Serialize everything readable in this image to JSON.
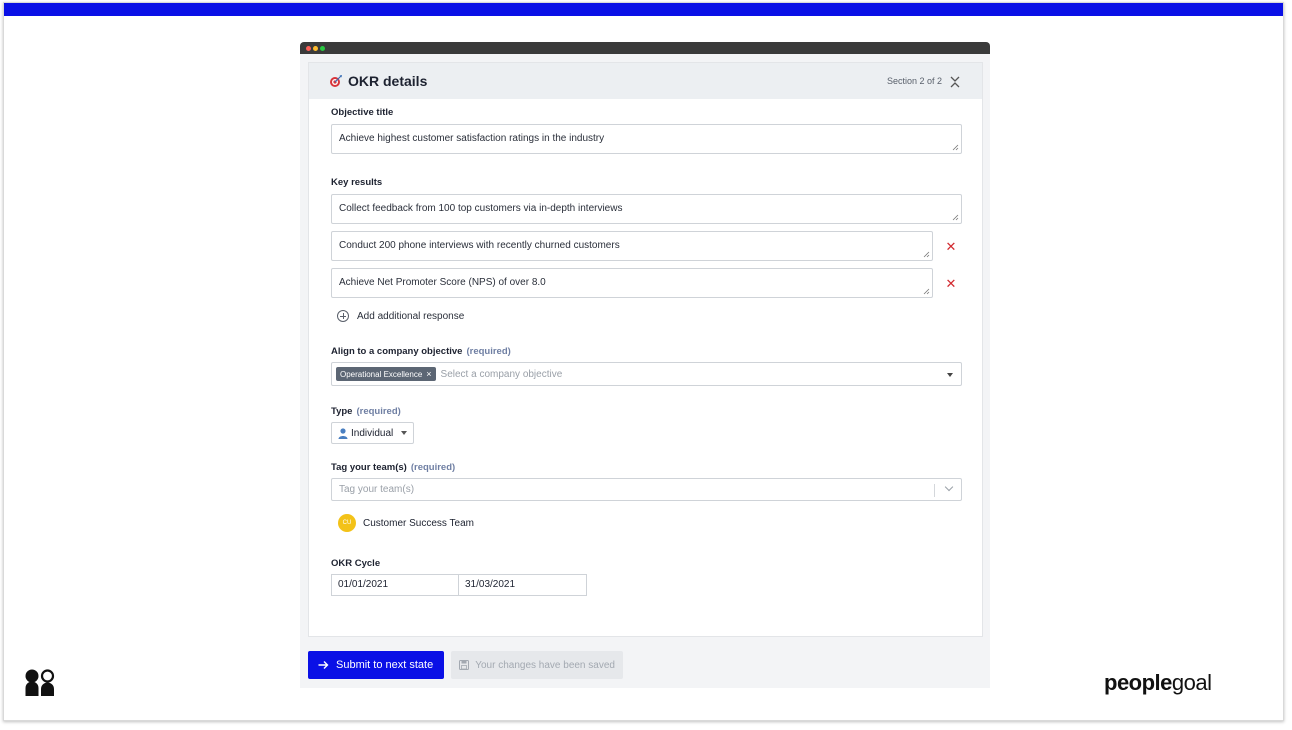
{
  "colors": {
    "accent_blue": "#0a10e6",
    "required_label": "#6f7fa3",
    "delete_red": "#d2292f",
    "chip_bg": "#5c6674",
    "avatar_yellow": "#f3c218"
  },
  "panel": {
    "title": "OKR details",
    "section": "Section 2 of 2",
    "icons": {
      "title_icon": "target-icon",
      "close_icon": "collapse-icon"
    }
  },
  "form": {
    "objective": {
      "label": "Objective title",
      "value": "Achieve highest customer satisfaction ratings in the industry"
    },
    "key_results": {
      "label": "Key results",
      "items": [
        "Collect feedback from 100 top customers via in-depth interviews",
        "Conduct 200 phone interviews with recently churned customers",
        "Achieve Net Promoter Score (NPS) of over 8.0"
      ],
      "delete_symbol": "✕",
      "add_label": "Add additional response"
    },
    "align": {
      "label": "Align to a company objective",
      "required": "(required)",
      "selected_chip": "Operational Excellence",
      "chip_remove": "×",
      "placeholder": "Select a company objective"
    },
    "type": {
      "label": "Type",
      "required": "(required)",
      "value": "Individual"
    },
    "teams": {
      "label": "Tag your team(s)",
      "required": "(required)",
      "placeholder": "Tag your team(s)",
      "items": [
        {
          "initials": "CU",
          "name": "Customer Success Team"
        }
      ]
    },
    "cycle": {
      "label": "OKR Cycle",
      "start": "01/01/2021",
      "end": "31/03/2021"
    }
  },
  "footer": {
    "submit_label": "Submit to next state",
    "saved_label": "Your changes have been saved"
  },
  "brand": {
    "bold": "people",
    "light": "goal"
  }
}
